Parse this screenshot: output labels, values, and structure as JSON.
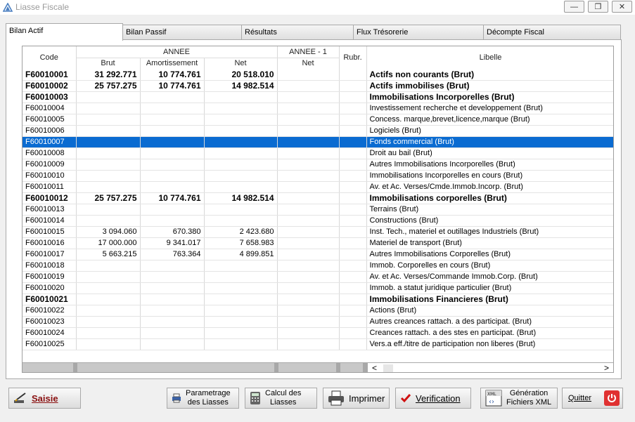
{
  "window": {
    "title": "Liasse Fiscale",
    "minimize": "—",
    "restore": "❐",
    "close": "✕"
  },
  "tabs": [
    {
      "label": "Bilan Actif"
    },
    {
      "label": "Bilan Passif"
    },
    {
      "label": "Résultats"
    },
    {
      "label": "Flux Trésorerie"
    },
    {
      "label": "Décompte Fiscal"
    }
  ],
  "table": {
    "headers": {
      "code": "Code",
      "annee": "ANNEE",
      "annee1": "ANNEE - 1",
      "rubr": "Rubr.",
      "libelle": "Libelle",
      "brut": "Brut",
      "amort": "Amortissement",
      "net": "Net",
      "net1": "Net"
    },
    "rows": [
      {
        "code": "F60010001",
        "brut": "31 292.771",
        "amort": "10 774.761",
        "net": "20 518.010",
        "libelle": "Actifs non courants (Brut)",
        "bold": true
      },
      {
        "code": "F60010002",
        "brut": "25 757.275",
        "amort": "10 774.761",
        "net": "14 982.514",
        "libelle": "Actifs immobilises (Brut)",
        "bold": true
      },
      {
        "code": "F60010003",
        "brut": "",
        "amort": "",
        "net": "",
        "libelle": "Immobilisations Incorporelles (Brut)",
        "bold": true
      },
      {
        "code": "F60010004",
        "brut": "",
        "amort": "",
        "net": "",
        "libelle": "Investissement recherche et developpement (Brut)"
      },
      {
        "code": "F60010005",
        "brut": "",
        "amort": "",
        "net": "",
        "libelle": "Concess. marque,brevet,licence,marque (Brut)"
      },
      {
        "code": "F60010006",
        "brut": "",
        "amort": "",
        "net": "",
        "libelle": "Logiciels (Brut)"
      },
      {
        "code": "F60010007",
        "brut": "",
        "amort": "",
        "net": "",
        "libelle": "Fonds commercial (Brut)",
        "selected": true
      },
      {
        "code": "F60010008",
        "brut": "",
        "amort": "",
        "net": "",
        "libelle": "Droit au bail (Brut)"
      },
      {
        "code": "F60010009",
        "brut": "",
        "amort": "",
        "net": "",
        "libelle": "Autres Immobilisations Incorporelles (Brut)"
      },
      {
        "code": "F60010010",
        "brut": "",
        "amort": "",
        "net": "",
        "libelle": "Immobilisations Incorporelles en cours (Brut)"
      },
      {
        "code": "F60010011",
        "brut": "",
        "amort": "",
        "net": "",
        "libelle": "Av. et Ac. Verses/Cmde.Immob.Incorp. (Brut)"
      },
      {
        "code": "F60010012",
        "brut": "25 757.275",
        "amort": "10 774.761",
        "net": "14 982.514",
        "libelle": "Immobilisations corporelles (Brut)",
        "bold": true
      },
      {
        "code": "F60010013",
        "brut": "",
        "amort": "",
        "net": "",
        "libelle": "Terrains (Brut)"
      },
      {
        "code": "F60010014",
        "brut": "",
        "amort": "",
        "net": "",
        "libelle": "Constructions (Brut)"
      },
      {
        "code": "F60010015",
        "brut": "3 094.060",
        "amort": "670.380",
        "net": "2 423.680",
        "libelle": "Inst. Tech., materiel et outillages Industriels (Brut)"
      },
      {
        "code": "F60010016",
        "brut": "17 000.000",
        "amort": "9 341.017",
        "net": "7 658.983",
        "libelle": "Materiel de transport  (Brut)"
      },
      {
        "code": "F60010017",
        "brut": "5 663.215",
        "amort": "763.364",
        "net": "4 899.851",
        "libelle": "Autres Immobilisations Corporelles  (Brut)"
      },
      {
        "code": "F60010018",
        "brut": "",
        "amort": "",
        "net": "",
        "libelle": "Immob. Corporelles en cours (Brut)"
      },
      {
        "code": "F60010019",
        "brut": "",
        "amort": "",
        "net": "",
        "libelle": "Av. et Ac. Verses/Commande Immob.Corp. (Brut)"
      },
      {
        "code": "F60010020",
        "brut": "",
        "amort": "",
        "net": "",
        "libelle": "Immob. a statut juridique particulier (Brut)"
      },
      {
        "code": "F60010021",
        "brut": "",
        "amort": "",
        "net": "",
        "libelle": "Immobilisations Financieres (Brut)",
        "bold": true
      },
      {
        "code": "F60010022",
        "brut": "",
        "amort": "",
        "net": "",
        "libelle": "Actions (Brut)"
      },
      {
        "code": "F60010023",
        "brut": "",
        "amort": "",
        "net": "",
        "libelle": "Autres creances rattach. a des participat. (Brut)"
      },
      {
        "code": "F60010024",
        "brut": "",
        "amort": "",
        "net": "",
        "libelle": "Creances rattach. a des stes en participat. (Brut)"
      },
      {
        "code": "F60010025",
        "brut": "",
        "amort": "",
        "net": "",
        "libelle": "Vers.a eff./titre de participation non liberes (Brut)"
      }
    ]
  },
  "scroll": {
    "left": "<",
    "right": ">"
  },
  "buttons": {
    "saisie": "Saisie",
    "parametrage_l1": "Parametrage",
    "parametrage_l2": "des Liasses",
    "calcul_l1": "Calcul des",
    "calcul_l2": "Liasses",
    "imprimer": "Imprimer",
    "verification": "Verification",
    "generation_l1": "Génération",
    "generation_l2": "Fichiers XML",
    "quitter": "Quitter"
  },
  "colors": {
    "selection": "#0a6bd1",
    "quit": "#e03131",
    "accent": "#4a7fc1"
  }
}
